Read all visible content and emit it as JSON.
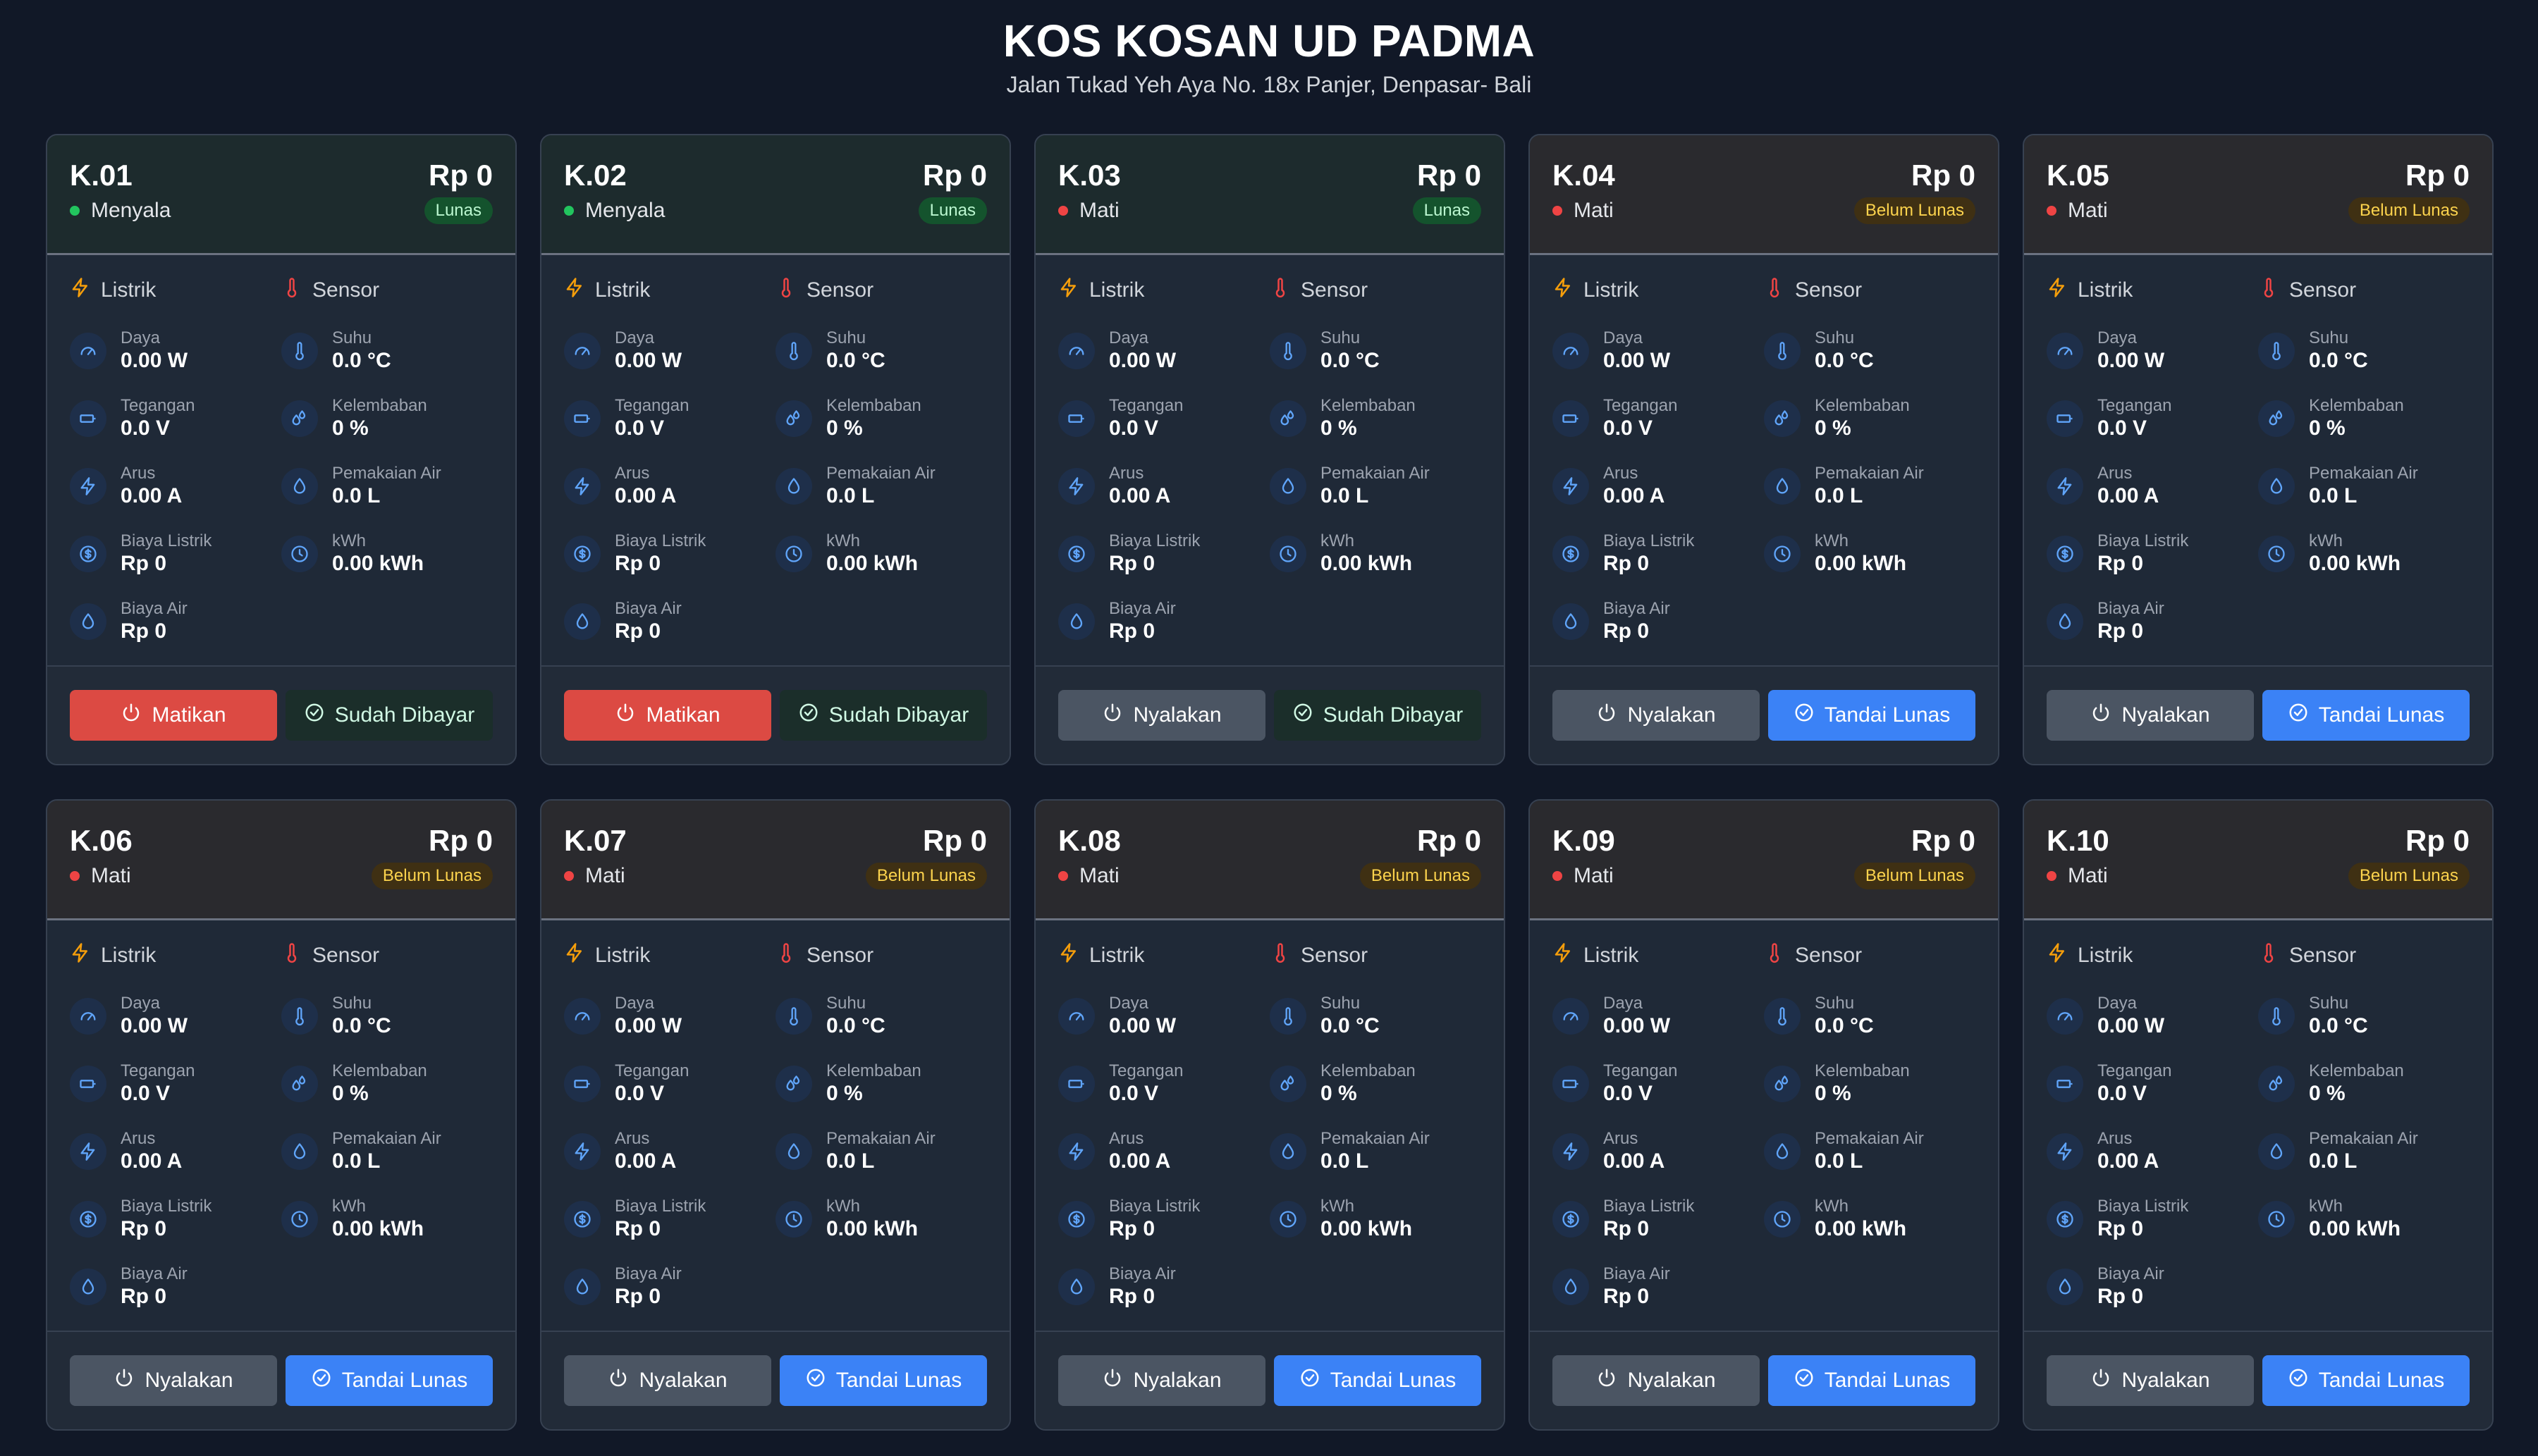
{
  "header": {
    "title": "KOS KOSAN UD PADMA",
    "address": "Jalan Tukad Yeh Aya No. 18x Panjer, Denpasar- Bali"
  },
  "labels": {
    "listrik": "Listrik",
    "sensor": "Sensor",
    "daya": "Daya",
    "tegangan": "Tegangan",
    "arus": "Arus",
    "biaya_listrik": "Biaya Listrik",
    "biaya_air": "Biaya Air",
    "suhu": "Suhu",
    "kelembaban": "Kelembaban",
    "pemakaian_air": "Pemakaian Air",
    "kwh": "kWh"
  },
  "colors": {
    "on": "#22c55e",
    "off": "#ef4444",
    "blue": "#3b82f6",
    "red": "#dc4a43"
  },
  "rooms": [
    {
      "room": "K.01",
      "amount": "Rp 0",
      "state": "Menyala",
      "on": true,
      "badge": "Lunas",
      "paid": true,
      "power_btn": "Matikan",
      "pay_btn": "Sudah Dibayar",
      "daya": "0.00 W",
      "tegangan": "0.0 V",
      "arus": "0.00 A",
      "biaya_listrik": "Rp 0",
      "biaya_air": "Rp 0",
      "suhu": "0.0 °C",
      "kelembaban": "0 %",
      "pemakaian_air": "0.0 L",
      "kwh": "0.00 kWh"
    },
    {
      "room": "K.02",
      "amount": "Rp 0",
      "state": "Menyala",
      "on": true,
      "badge": "Lunas",
      "paid": true,
      "power_btn": "Matikan",
      "pay_btn": "Sudah Dibayar",
      "daya": "0.00 W",
      "tegangan": "0.0 V",
      "arus": "0.00 A",
      "biaya_listrik": "Rp 0",
      "biaya_air": "Rp 0",
      "suhu": "0.0 °C",
      "kelembaban": "0 %",
      "pemakaian_air": "0.0 L",
      "kwh": "0.00 kWh"
    },
    {
      "room": "K.03",
      "amount": "Rp 0",
      "state": "Mati",
      "on": false,
      "badge": "Lunas",
      "paid": true,
      "power_btn": "Nyalakan",
      "pay_btn": "Sudah Dibayar",
      "daya": "0.00 W",
      "tegangan": "0.0 V",
      "arus": "0.00 A",
      "biaya_listrik": "Rp 0",
      "biaya_air": "Rp 0",
      "suhu": "0.0 °C",
      "kelembaban": "0 %",
      "pemakaian_air": "0.0 L",
      "kwh": "0.00 kWh"
    },
    {
      "room": "K.04",
      "amount": "Rp 0",
      "state": "Mati",
      "on": false,
      "badge": "Belum Lunas",
      "paid": false,
      "power_btn": "Nyalakan",
      "pay_btn": "Tandai Lunas",
      "daya": "0.00 W",
      "tegangan": "0.0 V",
      "arus": "0.00 A",
      "biaya_listrik": "Rp 0",
      "biaya_air": "Rp 0",
      "suhu": "0.0 °C",
      "kelembaban": "0 %",
      "pemakaian_air": "0.0 L",
      "kwh": "0.00 kWh"
    },
    {
      "room": "K.05",
      "amount": "Rp 0",
      "state": "Mati",
      "on": false,
      "badge": "Belum Lunas",
      "paid": false,
      "power_btn": "Nyalakan",
      "pay_btn": "Tandai Lunas",
      "daya": "0.00 W",
      "tegangan": "0.0 V",
      "arus": "0.00 A",
      "biaya_listrik": "Rp 0",
      "biaya_air": "Rp 0",
      "suhu": "0.0 °C",
      "kelembaban": "0 %",
      "pemakaian_air": "0.0 L",
      "kwh": "0.00 kWh"
    },
    {
      "room": "K.06",
      "amount": "Rp 0",
      "state": "Mati",
      "on": false,
      "badge": "Belum Lunas",
      "paid": false,
      "power_btn": "Nyalakan",
      "pay_btn": "Tandai Lunas",
      "daya": "0.00 W",
      "tegangan": "0.0 V",
      "arus": "0.00 A",
      "biaya_listrik": "Rp 0",
      "biaya_air": "Rp 0",
      "suhu": "0.0 °C",
      "kelembaban": "0 %",
      "pemakaian_air": "0.0 L",
      "kwh": "0.00 kWh"
    },
    {
      "room": "K.07",
      "amount": "Rp 0",
      "state": "Mati",
      "on": false,
      "badge": "Belum Lunas",
      "paid": false,
      "power_btn": "Nyalakan",
      "pay_btn": "Tandai Lunas",
      "daya": "0.00 W",
      "tegangan": "0.0 V",
      "arus": "0.00 A",
      "biaya_listrik": "Rp 0",
      "biaya_air": "Rp 0",
      "suhu": "0.0 °C",
      "kelembaban": "0 %",
      "pemakaian_air": "0.0 L",
      "kwh": "0.00 kWh"
    },
    {
      "room": "K.08",
      "amount": "Rp 0",
      "state": "Mati",
      "on": false,
      "badge": "Belum Lunas",
      "paid": false,
      "power_btn": "Nyalakan",
      "pay_btn": "Tandai Lunas",
      "daya": "0.00 W",
      "tegangan": "0.0 V",
      "arus": "0.00 A",
      "biaya_listrik": "Rp 0",
      "biaya_air": "Rp 0",
      "suhu": "0.0 °C",
      "kelembaban": "0 %",
      "pemakaian_air": "0.0 L",
      "kwh": "0.00 kWh"
    },
    {
      "room": "K.09",
      "amount": "Rp 0",
      "state": "Mati",
      "on": false,
      "badge": "Belum Lunas",
      "paid": false,
      "power_btn": "Nyalakan",
      "pay_btn": "Tandai Lunas",
      "daya": "0.00 W",
      "tegangan": "0.0 V",
      "arus": "0.00 A",
      "biaya_listrik": "Rp 0",
      "biaya_air": "Rp 0",
      "suhu": "0.0 °C",
      "kelembaban": "0 %",
      "pemakaian_air": "0.0 L",
      "kwh": "0.00 kWh"
    },
    {
      "room": "K.10",
      "amount": "Rp 0",
      "state": "Mati",
      "on": false,
      "badge": "Belum Lunas",
      "paid": false,
      "power_btn": "Nyalakan",
      "pay_btn": "Tandai Lunas",
      "daya": "0.00 W",
      "tegangan": "0.0 V",
      "arus": "0.00 A",
      "biaya_listrik": "Rp 0",
      "biaya_air": "Rp 0",
      "suhu": "0.0 °C",
      "kelembaban": "0 %",
      "pemakaian_air": "0.0 L",
      "kwh": "0.00 kWh"
    }
  ]
}
